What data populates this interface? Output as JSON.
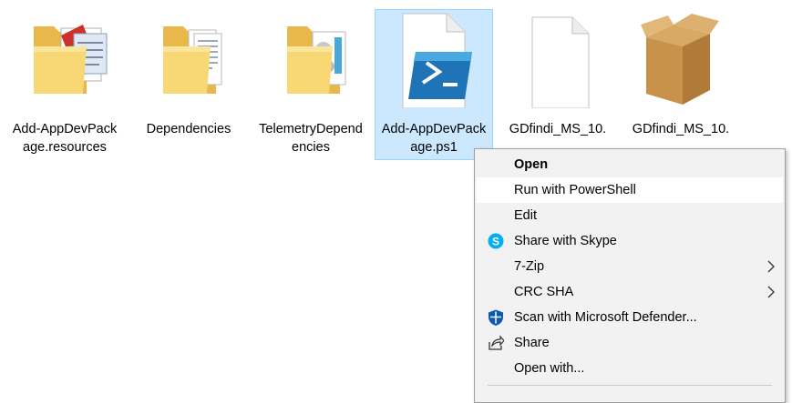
{
  "files": [
    {
      "name": "Add-AppDevPackage.resources",
      "type": "folder",
      "icon": "folder-notepad-icon",
      "selected": false
    },
    {
      "name": "Dependencies",
      "type": "folder",
      "icon": "folder-documents-icon",
      "selected": false
    },
    {
      "name": "TelemetryDependencies",
      "type": "folder",
      "icon": "folder-settings-icon",
      "selected": false
    },
    {
      "name": "Add-AppDevPackage.ps1",
      "type": "file",
      "icon": "powershell-script-icon",
      "selected": true
    },
    {
      "name": "GDfindi_MS_10.",
      "type": "file",
      "icon": "blank-file-icon",
      "selected": false
    },
    {
      "name": "GDfindi_MS_10.",
      "type": "file",
      "icon": "package-box-icon",
      "selected": false
    }
  ],
  "context_menu": {
    "items": [
      {
        "label": "Open",
        "bold": true,
        "icon": null,
        "submenu": false,
        "highlighted": false
      },
      {
        "label": "Run with PowerShell",
        "bold": false,
        "icon": null,
        "submenu": false,
        "highlighted": true
      },
      {
        "label": "Edit",
        "bold": false,
        "icon": null,
        "submenu": false,
        "highlighted": false
      },
      {
        "label": "Share with Skype",
        "bold": false,
        "icon": "skype-icon",
        "submenu": false,
        "highlighted": false
      },
      {
        "label": "7-Zip",
        "bold": false,
        "icon": null,
        "submenu": true,
        "highlighted": false
      },
      {
        "label": "CRC SHA",
        "bold": false,
        "icon": null,
        "submenu": true,
        "highlighted": false
      },
      {
        "label": "Scan with Microsoft Defender...",
        "bold": false,
        "icon": "defender-shield-icon",
        "submenu": false,
        "highlighted": false
      },
      {
        "label": "Share",
        "bold": false,
        "icon": "share-icon",
        "submenu": false,
        "highlighted": false
      },
      {
        "label": "Open with...",
        "bold": false,
        "icon": null,
        "submenu": false,
        "highlighted": false
      }
    ]
  },
  "colors": {
    "selection_bg": "#cce8ff",
    "selection_border": "#99d1ff",
    "menu_bg": "#f2f2f2",
    "menu_highlight": "#ffffff",
    "folder_yellow": "#f8d775",
    "skype_blue": "#00aff0",
    "defender_blue": "#0a5ab4"
  }
}
